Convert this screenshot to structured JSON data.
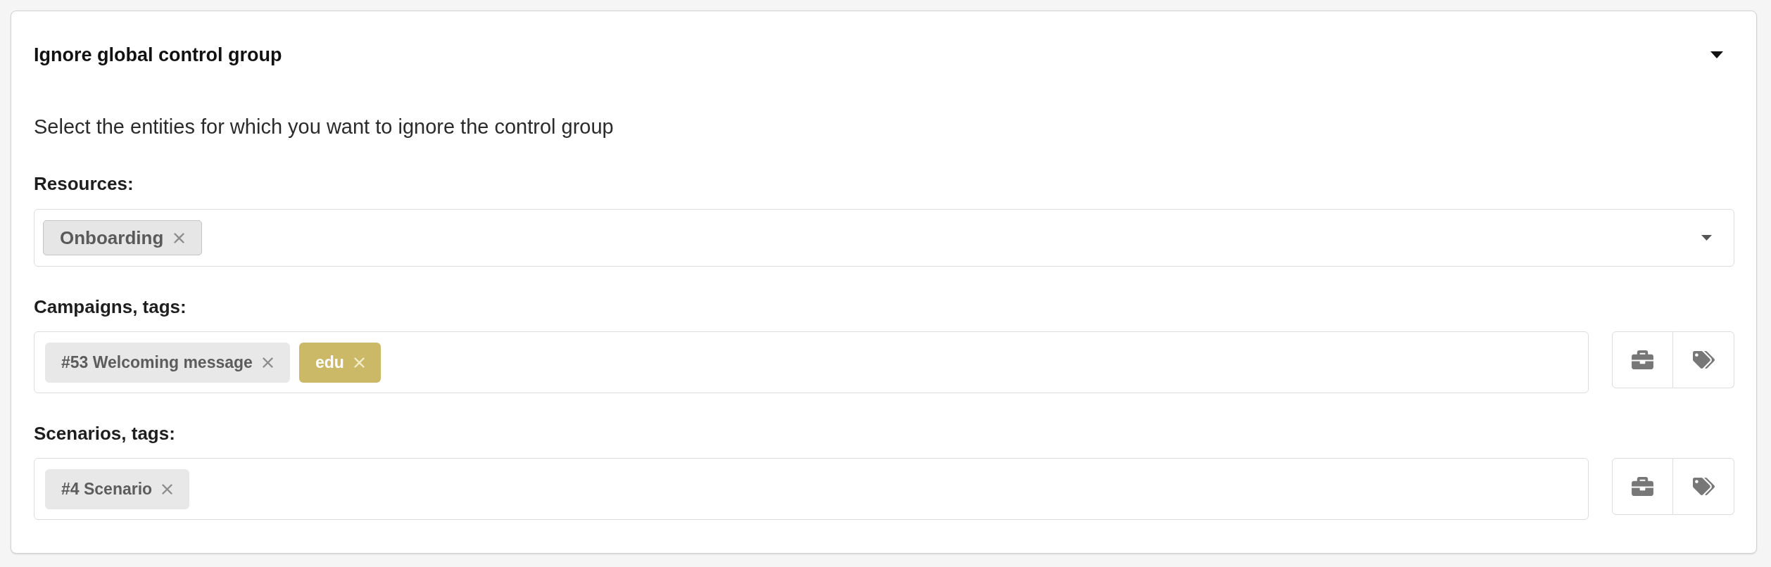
{
  "section": {
    "title": "Ignore global control group",
    "expanded": true,
    "description": "Select the entities for which you want to ignore the control group"
  },
  "fields": [
    {
      "kind": "select",
      "label": "Resources:",
      "chips": [
        {
          "kind": "resource",
          "text": "Onboarding"
        }
      ]
    },
    {
      "kind": "picker",
      "label": "Campaigns, tags:",
      "chips": [
        {
          "kind": "entity",
          "text": "#53 Welcoming message"
        },
        {
          "kind": "tag",
          "text": "edu",
          "color": "#cbb967"
        }
      ]
    },
    {
      "kind": "picker",
      "label": "Scenarios, tags:",
      "chips": [
        {
          "kind": "entity",
          "text": "#4 Scenario"
        }
      ]
    }
  ]
}
